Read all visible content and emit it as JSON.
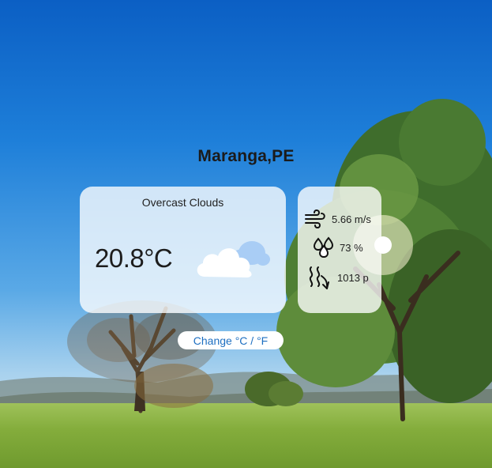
{
  "location": {
    "city": "Maranga,PE"
  },
  "current": {
    "description": "Overcast Clouds",
    "temperature": "20.8°C",
    "condition_icon": "overcast-clouds-icon"
  },
  "details": {
    "wind": {
      "icon": "wind-icon",
      "value": "5.66 m/s"
    },
    "humidity": {
      "icon": "humidity-drops-icon",
      "value": "73 %"
    },
    "pressure": {
      "icon": "pressure-waves-icon",
      "value": "1013 p"
    }
  },
  "controls": {
    "unit_toggle_label": "Change °C / °F"
  },
  "colors": {
    "sky_top": "#0b5fc4",
    "card_bg": "rgba(255,255,255,0.78)",
    "toggle_text": "#1e6fc1",
    "cloud_accent": "#a9cdf5"
  }
}
